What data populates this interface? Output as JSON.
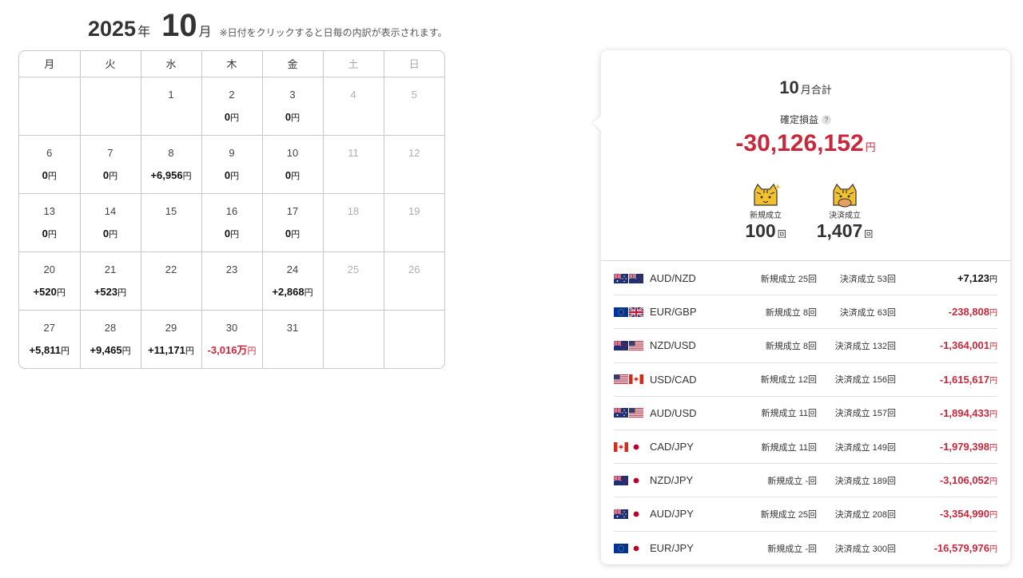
{
  "header": {
    "year": "2025",
    "year_unit": "年",
    "month": "10",
    "month_unit": "月",
    "note": "※日付をクリックすると日毎の内訳が表示されます。"
  },
  "weekdays": [
    "月",
    "火",
    "水",
    "木",
    "金",
    "土",
    "日"
  ],
  "weeks": [
    [
      {
        "day": "",
        "amount": ""
      },
      {
        "day": "",
        "amount": ""
      },
      {
        "day": "1",
        "amount": ""
      },
      {
        "day": "2",
        "amount": "0",
        "unit": "円"
      },
      {
        "day": "3",
        "amount": "0",
        "unit": "円"
      },
      {
        "day": "4",
        "amount": ""
      },
      {
        "day": "5",
        "amount": ""
      }
    ],
    [
      {
        "day": "6",
        "amount": "0",
        "unit": "円"
      },
      {
        "day": "7",
        "amount": "0",
        "unit": "円"
      },
      {
        "day": "8",
        "amount": "+6,956",
        "unit": "円"
      },
      {
        "day": "9",
        "amount": "0",
        "unit": "円"
      },
      {
        "day": "10",
        "amount": "0",
        "unit": "円"
      },
      {
        "day": "11",
        "amount": ""
      },
      {
        "day": "12",
        "amount": ""
      }
    ],
    [
      {
        "day": "13",
        "amount": "0",
        "unit": "円"
      },
      {
        "day": "14",
        "amount": "0",
        "unit": "円"
      },
      {
        "day": "15",
        "amount": ""
      },
      {
        "day": "16",
        "amount": "0",
        "unit": "円"
      },
      {
        "day": "17",
        "amount": "0",
        "unit": "円"
      },
      {
        "day": "18",
        "amount": ""
      },
      {
        "day": "19",
        "amount": ""
      }
    ],
    [
      {
        "day": "20",
        "amount": "+520",
        "unit": "円"
      },
      {
        "day": "21",
        "amount": "+523",
        "unit": "円"
      },
      {
        "day": "22",
        "amount": ""
      },
      {
        "day": "23",
        "amount": ""
      },
      {
        "day": "24",
        "amount": "+2,868",
        "unit": "円"
      },
      {
        "day": "25",
        "amount": ""
      },
      {
        "day": "26",
        "amount": ""
      }
    ],
    [
      {
        "day": "27",
        "amount": "+5,811",
        "unit": "円"
      },
      {
        "day": "28",
        "amount": "+9,465",
        "unit": "円"
      },
      {
        "day": "29",
        "amount": "+11,171",
        "unit": "円"
      },
      {
        "day": "30",
        "amount": "-3,016万",
        "unit": "円",
        "negative": true
      },
      {
        "day": "31",
        "amount": ""
      },
      {
        "day": "",
        "amount": ""
      },
      {
        "day": "",
        "amount": ""
      }
    ]
  ],
  "summary": {
    "month": "10",
    "month_label": "月合計",
    "pl_label": "確定損益",
    "help_glyph": "?",
    "pl_value": "-30,126,152",
    "yen": "円",
    "new_label": "新規成立",
    "new_value": "100",
    "close_label": "決済成立",
    "close_value": "1,407",
    "count_unit": "回"
  },
  "pairs": [
    {
      "flags": [
        "au",
        "nz"
      ],
      "name": "AUD/NZD",
      "new": "新規成立 25回",
      "close": "決済成立 53回",
      "pl": "+7,123",
      "negative": false
    },
    {
      "flags": [
        "eu",
        "gb"
      ],
      "name": "EUR/GBP",
      "new": "新規成立 8回",
      "close": "決済成立 63回",
      "pl": "-238,808",
      "negative": true
    },
    {
      "flags": [
        "nz",
        "us"
      ],
      "name": "NZD/USD",
      "new": "新規成立 8回",
      "close": "決済成立 132回",
      "pl": "-1,364,001",
      "negative": true
    },
    {
      "flags": [
        "us",
        "ca"
      ],
      "name": "USD/CAD",
      "new": "新規成立 12回",
      "close": "決済成立 156回",
      "pl": "-1,615,617",
      "negative": true
    },
    {
      "flags": [
        "au",
        "us"
      ],
      "name": "AUD/USD",
      "new": "新規成立 11回",
      "close": "決済成立 157回",
      "pl": "-1,894,433",
      "negative": true
    },
    {
      "flags": [
        "ca",
        "jp"
      ],
      "name": "CAD/JPY",
      "new": "新規成立 11回",
      "close": "決済成立 149回",
      "pl": "-1,979,398",
      "negative": true
    },
    {
      "flags": [
        "nz",
        "jp"
      ],
      "name": "NZD/JPY",
      "new": "新規成立 -回",
      "close": "決済成立 189回",
      "pl": "-3,106,052",
      "negative": true
    },
    {
      "flags": [
        "au",
        "jp"
      ],
      "name": "AUD/JPY",
      "new": "新規成立 25回",
      "close": "決済成立 208回",
      "pl": "-3,354,990",
      "negative": true
    },
    {
      "flags": [
        "eu",
        "jp"
      ],
      "name": "EUR/JPY",
      "new": "新規成立 -回",
      "close": "決済成立 300回",
      "pl": "-16,579,976",
      "negative": true
    }
  ],
  "colors": {
    "negative": "#c8283c",
    "positive": "#111111",
    "border": "#c8c8c8",
    "mascot": "#f2c12e"
  }
}
